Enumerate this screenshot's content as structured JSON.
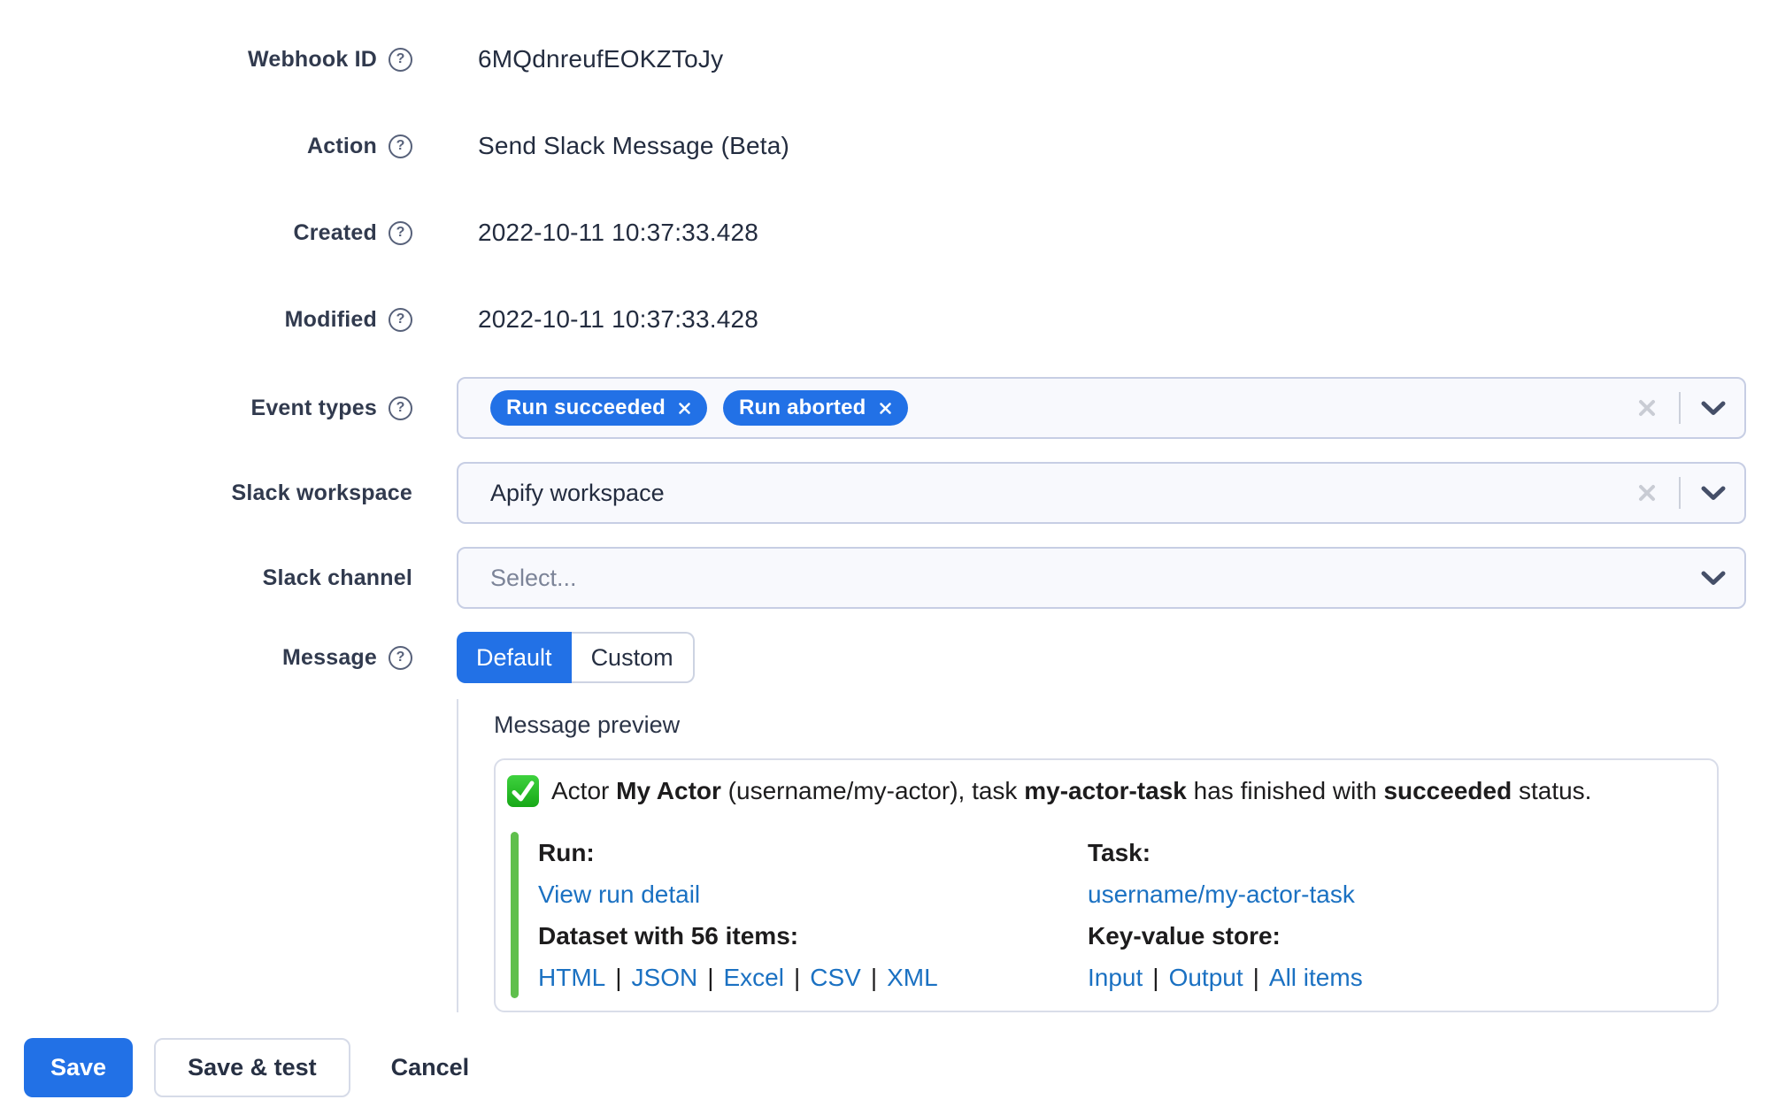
{
  "colors": {
    "accent": "#2271e6",
    "link": "#1b71c2",
    "green": "#5fbf4c"
  },
  "glyphs": {
    "help": "?"
  },
  "separator": "|",
  "form": {
    "static_fields": [
      {
        "label": "Webhook ID",
        "value": "6MQdnreufEOKZToJy"
      },
      {
        "label": "Action",
        "value": "Send Slack Message (Beta)"
      },
      {
        "label": "Created",
        "value": "2022-10-11 10:37:33.428"
      },
      {
        "label": "Modified",
        "value": "2022-10-11 10:37:33.428"
      }
    ],
    "event_types": {
      "label": "Event types",
      "tags": [
        {
          "text": "Run succeeded"
        },
        {
          "text": "Run aborted"
        }
      ]
    },
    "slack_workspace": {
      "label": "Slack workspace",
      "value": "Apify workspace"
    },
    "slack_channel": {
      "label": "Slack channel",
      "placeholder": "Select..."
    },
    "message": {
      "label": "Message",
      "tabs": [
        {
          "label": "Default",
          "active": true
        },
        {
          "label": "Custom",
          "active": false
        }
      ]
    }
  },
  "preview": {
    "heading": "Message preview",
    "status_line": {
      "prefix": "Actor ",
      "actor_name": "My Actor",
      "middle1": " (username/my-actor), task ",
      "task_name": "my-actor-task",
      "middle2": " has finished with ",
      "status": "succeeded",
      "suffix": " status."
    },
    "run_column": {
      "title": "Run:",
      "link": "View run detail",
      "dataset_title": "Dataset with 56 items:",
      "format_links": [
        "HTML",
        "JSON",
        "Excel",
        "CSV",
        "XML"
      ]
    },
    "task_column": {
      "title": "Task:",
      "link": "username/my-actor-task",
      "store_title": "Key-value store:",
      "store_links": [
        "Input",
        "Output",
        "All items"
      ]
    }
  },
  "actions": {
    "save": "Save",
    "save_and_test": "Save & test",
    "cancel": "Cancel"
  }
}
